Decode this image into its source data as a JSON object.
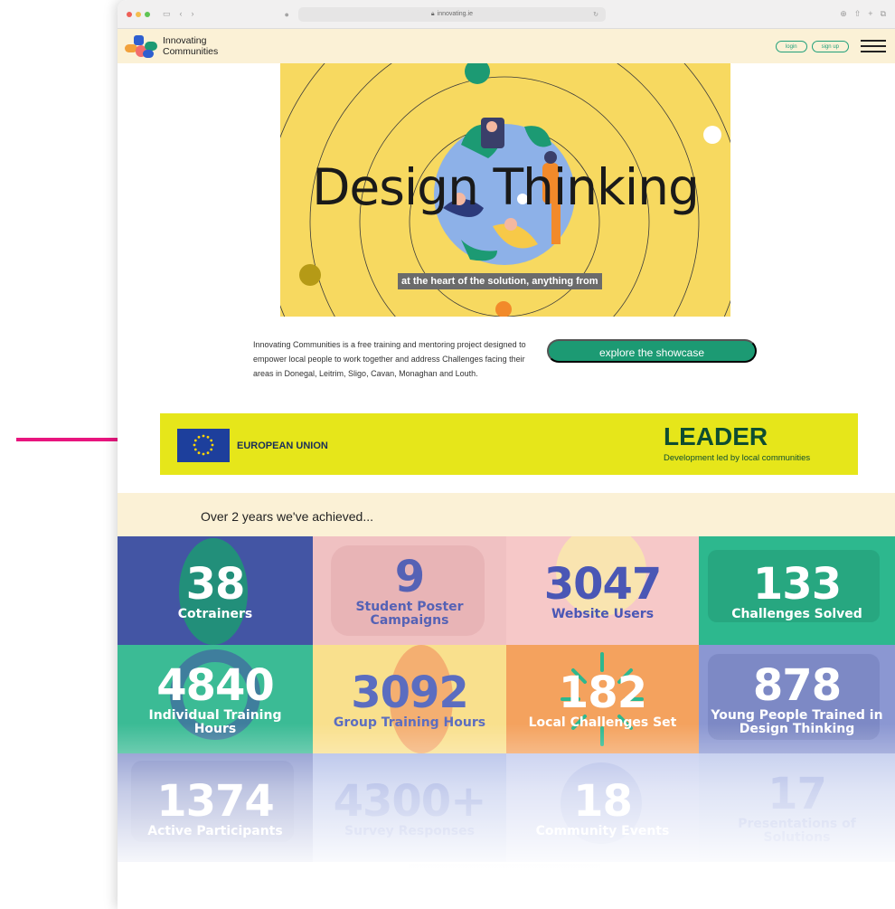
{
  "browser": {
    "url": "innovating.ie"
  },
  "header": {
    "brand_line1": "Innovating",
    "brand_line2": "Communities",
    "login_label": "login",
    "signup_label": "sign up"
  },
  "hero": {
    "title": "Design Thinking",
    "caption": "at the heart of the solution, anything from"
  },
  "intro": {
    "text": "Innovating Communities is a free training and mentoring project designed to empower local people to work together and address Challenges facing their areas in Donegal, Leitrim, Sligo, Cavan, Monaghan and Louth.",
    "cta_label": "explore the showcase"
  },
  "funding": {
    "eu_label": "EUROPEAN UNION",
    "leader_title": "LEADER",
    "leader_subtitle": "Development led by local communities"
  },
  "achievements": {
    "heading": "Over 2 years we've achieved...",
    "stats": [
      {
        "value": "38",
        "label": "Cotrainers",
        "bg": "#4355a4",
        "text": "#ffffff"
      },
      {
        "value": "9",
        "label": "Student Poster Campaigns",
        "bg": "#f0c1c2",
        "text": "#5562b5"
      },
      {
        "value": "3047",
        "label": "Website Users",
        "bg": "#f6c8c8",
        "text": "#4a57b5"
      },
      {
        "value": "133",
        "label": "Challenges Solved",
        "bg": "#2db88e",
        "text": "#ffffff"
      },
      {
        "value": "4840",
        "label": "Individual Training Hours",
        "bg": "#3bbb95",
        "text": "#ffffff"
      },
      {
        "value": "3092",
        "label": "Group Training Hours",
        "bg": "#f9e08d",
        "text": "#5b6dc0"
      },
      {
        "value": "182",
        "label": "Local Challenges Set",
        "bg": "#f4a25e",
        "text": "#ffffff"
      },
      {
        "value": "878",
        "label": "Young People Trained in Design Thinking",
        "bg": "#8b97d2",
        "text": "#ffffff"
      },
      {
        "value": "1374",
        "label": "Active Participants",
        "bg": "#7b89c8",
        "text": "#ffffff"
      },
      {
        "value": "4300+",
        "label": "Survey Responses",
        "bg": "#a9b7e6",
        "text": "#7d8fd6"
      },
      {
        "value": "18",
        "label": "Community Events",
        "bg": "#bdc6ec",
        "text": "#ffffff"
      },
      {
        "value": "17",
        "label": "Presentations of Solutions",
        "bg": "#b7c3ea",
        "text": "#8f9fdc"
      }
    ]
  },
  "colors": {
    "accent_green": "#1c9a73",
    "hero_yellow": "#f7d960",
    "funding_yellow": "#e6e61a",
    "cream": "#fbf1d6",
    "pointer_arrow": "#e8157e"
  }
}
